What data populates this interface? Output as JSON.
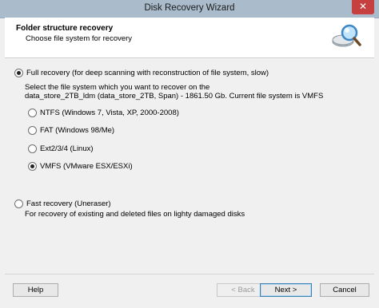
{
  "window": {
    "title": "Disk Recovery Wizard",
    "close_symbol": "✕"
  },
  "header": {
    "title": "Folder structure recovery",
    "subtitle": "Choose file system for recovery",
    "icon": "magnifier-disk-icon"
  },
  "options": {
    "full": {
      "label": "Full recovery (for deep scanning with reconstruction of file system, slow)",
      "selected": true,
      "desc_line1": "Select the file system which you want to recover on the",
      "desc_line2": "data_store_2TB_ldm (data_store_2TB, Span) - 1861.50 Gb. Current file system is VMFS"
    },
    "filesystems": [
      {
        "label": "NTFS (Windows 7, Vista, XP, 2000-2008)",
        "selected": false
      },
      {
        "label": "FAT (Windows 98/Me)",
        "selected": false
      },
      {
        "label": "Ext2/3/4 (Linux)",
        "selected": false
      },
      {
        "label": "VMFS (VMware ESX/ESXi)",
        "selected": true
      }
    ],
    "fast": {
      "label": "Fast recovery (Uneraser)",
      "selected": false,
      "desc": "For recovery of existing and deleted files on lighty damaged disks"
    }
  },
  "buttons": {
    "help": "Help",
    "back": "< Back",
    "next": "Next >",
    "cancel": "Cancel"
  }
}
